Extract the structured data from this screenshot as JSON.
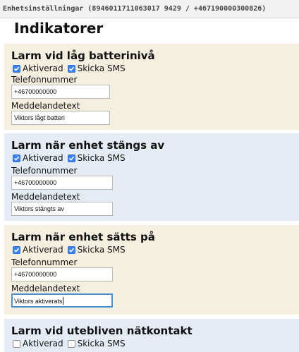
{
  "window": {
    "title": "Enhetsinställningar (8946011711063017 9429 / +467190000300826)"
  },
  "page": {
    "title": "Indikatorer"
  },
  "sections": [
    {
      "title": "Larm vid låg batterinivå",
      "activated_label": "Aktiverad",
      "activated": true,
      "sms_label": "Skicka SMS",
      "sms": true,
      "phone_label": "Telefonnummer",
      "phone_value": "+46700000000",
      "message_label": "Meddelandetext",
      "message_value": "Viktors lågt batteri"
    },
    {
      "title": "Larm när enhet stängs av",
      "activated_label": "Aktiverad",
      "activated": true,
      "sms_label": "Skicka SMS",
      "sms": true,
      "phone_label": "Telefonnummer",
      "phone_value": "+46700000000",
      "message_label": "Meddelandetext",
      "message_value": "Viktors stängts av"
    },
    {
      "title": "Larm när enhet sätts på",
      "activated_label": "Aktiverad",
      "activated": true,
      "sms_label": "Skicka SMS",
      "sms": true,
      "phone_label": "Telefonnummer",
      "phone_value": "+46700000000",
      "message_label": "Meddelandetext",
      "message_value": "Viktors aktiverats"
    },
    {
      "title": "Larm vid utebliven nätkontakt",
      "activated_label": "Aktiverad",
      "activated": false,
      "sms_label": "Skicka SMS",
      "sms": false
    }
  ],
  "colors": {
    "section_a": "#f5efe0",
    "section_b": "#e6ecf5",
    "checkbox_on": "#3b82f6",
    "focus_ring": "#4a90d9"
  }
}
